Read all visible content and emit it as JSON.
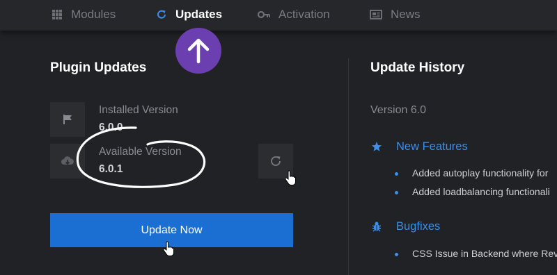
{
  "nav": {
    "items": [
      {
        "label": "Modules",
        "icon": "grid-icon"
      },
      {
        "label": "Updates",
        "icon": "refresh-icon",
        "active": true
      },
      {
        "label": "Activation",
        "icon": "key-icon"
      },
      {
        "label": "News",
        "icon": "newspaper-icon"
      }
    ]
  },
  "plugin_updates": {
    "title": "Plugin Updates",
    "installed_label": "Installed Version",
    "installed_value": "6.0.0",
    "available_label": "Available Version",
    "available_value": "6.0.1",
    "update_button": "Update Now"
  },
  "history": {
    "title": "Update History",
    "version": "Version 6.0",
    "features_heading": "New Features",
    "features": [
      "Added autoplay functionality for",
      "Added loadbalancing functionali"
    ],
    "bugfix_heading": "Bugfixes",
    "bugfixes": [
      "CSS Issue in Backend where Rev"
    ]
  },
  "colors": {
    "background": "#212226",
    "nav_background": "#26272b",
    "accent_blue": "#1b6fd3",
    "link_blue": "#3d8fe8",
    "badge_purple": "#6c3fb1"
  }
}
